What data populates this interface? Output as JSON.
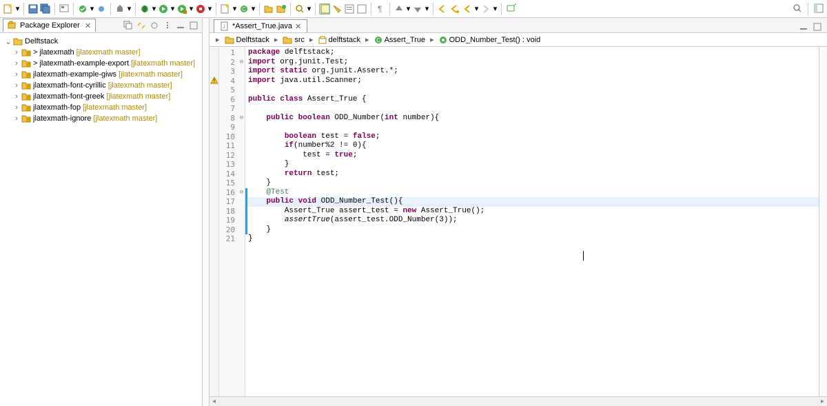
{
  "toolbar": {
    "active_tool": "toggle-breadcrumb"
  },
  "package_explorer": {
    "title": "Package Explorer",
    "items": [
      {
        "name": "Delftstack",
        "branch": ""
      },
      {
        "name": "> jlatexmath",
        "branch": " [jlatexmath master]"
      },
      {
        "name": "> jlatexmath-example-export",
        "branch": " [jlatexmath master]"
      },
      {
        "name": "jlatexmath-example-giws",
        "branch": " [jlatexmath master]"
      },
      {
        "name": "jlatexmath-font-cyrillic",
        "branch": " [jlatexmath master]"
      },
      {
        "name": "jlatexmath-font-greek",
        "branch": " [jlatexmath master]"
      },
      {
        "name": "jlatexmath-fop",
        "branch": " [jlatexmath master]"
      },
      {
        "name": "jlatexmath-ignore",
        "branch": " [jlatexmath master]"
      }
    ]
  },
  "editor_tab": {
    "label": "*Assert_True.java"
  },
  "breadcrumb": {
    "items": [
      {
        "icon": "proj",
        "label": "Delftstack"
      },
      {
        "icon": "folder",
        "label": "src"
      },
      {
        "icon": "package",
        "label": "delftstack"
      },
      {
        "icon": "class",
        "label": "Assert_True"
      },
      {
        "icon": "method",
        "label": "ODD_Number_Test() : void"
      }
    ]
  },
  "code": {
    "lines": [
      {
        "n": 1,
        "fold": "",
        "html": "<span class='k'>package</span> delftstack;"
      },
      {
        "n": 2,
        "fold": "⊖",
        "html": "<span class='k'>import</span> org.junit.Test;"
      },
      {
        "n": 3,
        "fold": "",
        "html": "<span class='k'>import static</span> org.junit.Assert.*;"
      },
      {
        "n": 4,
        "fold": "",
        "html": "<span class='k'>import</span> java.util.Scanner;",
        "marker": "warn"
      },
      {
        "n": 5,
        "fold": "",
        "html": ""
      },
      {
        "n": 6,
        "fold": "",
        "html": "<span class='k'>public class</span> Assert_True {"
      },
      {
        "n": 7,
        "fold": "",
        "html": ""
      },
      {
        "n": 8,
        "fold": "⊖",
        "html": "    <span class='k'>public boolean</span> ODD_Number(<span class='k'>int</span> number){"
      },
      {
        "n": 9,
        "fold": "",
        "html": ""
      },
      {
        "n": 10,
        "fold": "",
        "html": "        <span class='k'>boolean</span> test = <span class='k'>false</span>;"
      },
      {
        "n": 11,
        "fold": "",
        "html": "        <span class='k'>if</span>(number%2 != 0){"
      },
      {
        "n": 12,
        "fold": "",
        "html": "            test = <span class='k'>true</span>;"
      },
      {
        "n": 13,
        "fold": "",
        "html": "        }"
      },
      {
        "n": 14,
        "fold": "",
        "html": "        <span class='k'>return</span> test;"
      },
      {
        "n": 15,
        "fold": "",
        "html": "    }"
      },
      {
        "n": 16,
        "fold": "⊖",
        "html": "    <span class='c'>@Test</span>"
      },
      {
        "n": 17,
        "fold": "",
        "html": "    <span class='k'>public void</span> ODD_Number_Test(){",
        "hl": true
      },
      {
        "n": 18,
        "fold": "",
        "html": "        Assert_True assert_test = <span class='k'>new</span> Assert_True();"
      },
      {
        "n": 19,
        "fold": "",
        "html": "        <span class='i'>assertTrue</span>(assert_test.ODD_Number(3));"
      },
      {
        "n": 20,
        "fold": "",
        "html": "    }"
      },
      {
        "n": 21,
        "fold": "",
        "html": "}"
      }
    ],
    "selection_start": 16,
    "selection_end": 20
  }
}
